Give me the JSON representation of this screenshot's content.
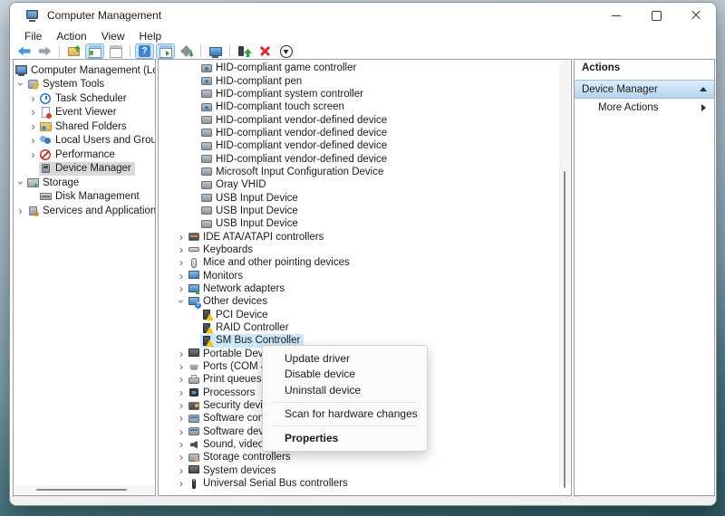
{
  "window": {
    "title": "Computer Management"
  },
  "menus": {
    "items": [
      {
        "label": "File"
      },
      {
        "label": "Action"
      },
      {
        "label": "View"
      },
      {
        "label": "Help"
      }
    ]
  },
  "toolbar": {
    "items": [
      {
        "name": "back-icon",
        "icon": "arrow-left"
      },
      {
        "name": "forward-icon",
        "icon": "arrow-right"
      },
      {
        "name": "toolbar-separator",
        "type": "sep"
      },
      {
        "name": "folder-up-icon",
        "icon": "folder-up"
      },
      {
        "name": "console-tree-icon",
        "icon": "window-tree",
        "active": "1"
      },
      {
        "name": "properties-window-icon",
        "icon": "window-gray"
      },
      {
        "name": "toolbar-separator",
        "type": "sep"
      },
      {
        "name": "help-icon",
        "icon": "help",
        "active": "1"
      },
      {
        "name": "action-pane-icon",
        "icon": "window-play",
        "active": "1"
      },
      {
        "name": "export-list-icon",
        "icon": "gear-export"
      },
      {
        "name": "toolbar-separator",
        "type": "sep"
      },
      {
        "name": "scan-hardware-icon",
        "icon": "monitor-scan"
      },
      {
        "name": "toolbar-separator",
        "type": "sep"
      },
      {
        "name": "update-driver-icon",
        "icon": "device-up"
      },
      {
        "name": "uninstall-device-icon",
        "icon": "red-x"
      },
      {
        "name": "disable-device-icon",
        "icon": "circle-down"
      }
    ]
  },
  "tree": {
    "items": [
      {
        "label": "Computer Management (Local",
        "ind": "0",
        "icon": "computer"
      },
      {
        "label": "System Tools",
        "ind": "1",
        "chev": "down",
        "icon": "tools"
      },
      {
        "label": "Task Scheduler",
        "ind": "2",
        "chev": "right",
        "icon": "clock"
      },
      {
        "label": "Event Viewer",
        "ind": "2",
        "chev": "right",
        "icon": "eventlog"
      },
      {
        "label": "Shared Folders",
        "ind": "2",
        "chev": "right",
        "icon": "sharedfolder"
      },
      {
        "label": "Local Users and Groups",
        "ind": "2",
        "chev": "right",
        "icon": "users"
      },
      {
        "label": "Performance",
        "ind": "2",
        "chev": "right",
        "icon": "performance"
      },
      {
        "label": "Device Manager",
        "ind": "2",
        "icon": "devmgr",
        "sel": "gray"
      },
      {
        "label": "Storage",
        "ind": "1",
        "chev": "down",
        "icon": "storage"
      },
      {
        "label": "Disk Management",
        "ind": "2",
        "icon": "disk"
      },
      {
        "label": "Services and Applications",
        "ind": "1",
        "chev": "right",
        "icon": "services"
      }
    ]
  },
  "devices": {
    "items": [
      {
        "label": "HID-compliant game controller",
        "ind": "2",
        "icon": "hid"
      },
      {
        "label": "HID-compliant pen",
        "ind": "2",
        "icon": "hid"
      },
      {
        "label": "HID-compliant system controller",
        "ind": "2",
        "icon": "input"
      },
      {
        "label": "HID-compliant touch screen",
        "ind": "2",
        "icon": "hid"
      },
      {
        "label": "HID-compliant vendor-defined device",
        "ind": "2",
        "icon": "input"
      },
      {
        "label": "HID-compliant vendor-defined device",
        "ind": "2",
        "icon": "input"
      },
      {
        "label": "HID-compliant vendor-defined device",
        "ind": "2",
        "icon": "input"
      },
      {
        "label": "HID-compliant vendor-defined device",
        "ind": "2",
        "icon": "input"
      },
      {
        "label": "Microsoft Input Configuration Device",
        "ind": "2",
        "icon": "input"
      },
      {
        "label": "Oray VHID",
        "ind": "2",
        "icon": "input"
      },
      {
        "label": "USB Input Device",
        "ind": "2",
        "icon": "input"
      },
      {
        "label": "USB Input Device",
        "ind": "2",
        "icon": "input"
      },
      {
        "label": "USB Input Device",
        "ind": "2",
        "icon": "input"
      },
      {
        "label": "IDE ATA/ATAPI controllers",
        "ind": "1",
        "chev": "right",
        "icon": "ide"
      },
      {
        "label": "Keyboards",
        "ind": "1",
        "chev": "right",
        "icon": "keyboard"
      },
      {
        "label": "Mice and other pointing devices",
        "ind": "1",
        "chev": "right",
        "icon": "mouse"
      },
      {
        "label": "Monitors",
        "ind": "1",
        "chev": "right",
        "icon": "monitor"
      },
      {
        "label": "Network adapters",
        "ind": "1",
        "chev": "right",
        "icon": "network"
      },
      {
        "label": "Other devices",
        "ind": "1",
        "chev": "down",
        "icon": "other"
      },
      {
        "label": "PCI Device",
        "ind": "2",
        "icon": "unknown",
        "warn": "1"
      },
      {
        "label": "RAID Controller",
        "ind": "2",
        "icon": "unknown",
        "warn": "1"
      },
      {
        "label": "SM Bus Controller",
        "ind": "2",
        "icon": "unknown",
        "warn": "1",
        "sel": "blue"
      },
      {
        "label": "Portable Devices",
        "ind": "1",
        "chev": "right",
        "icon": "portable"
      },
      {
        "label": "Ports (COM & LPT)",
        "ind": "1",
        "chev": "right",
        "icon": "ports"
      },
      {
        "label": "Print queues",
        "ind": "1",
        "chev": "right",
        "icon": "printer"
      },
      {
        "label": "Processors",
        "ind": "1",
        "chev": "right",
        "icon": "processor"
      },
      {
        "label": "Security devices",
        "ind": "1",
        "chev": "right",
        "icon": "security"
      },
      {
        "label": "Software components",
        "ind": "1",
        "chev": "right",
        "icon": "software"
      },
      {
        "label": "Software devices",
        "ind": "1",
        "chev": "right",
        "icon": "software"
      },
      {
        "label": "Sound, video and game controllers",
        "ind": "1",
        "chev": "right",
        "icon": "sound"
      },
      {
        "label": "Storage controllers",
        "ind": "1",
        "chev": "right",
        "icon": "storagec"
      },
      {
        "label": "System devices",
        "ind": "1",
        "chev": "right",
        "icon": "system"
      },
      {
        "label": "Universal Serial Bus controllers",
        "ind": "1",
        "chev": "right",
        "icon": "usb"
      }
    ]
  },
  "context_menu": {
    "items": [
      {
        "label": "Update driver"
      },
      {
        "label": "Disable device"
      },
      {
        "label": "Uninstall device"
      },
      {
        "type": "sep"
      },
      {
        "label": "Scan for hardware changes"
      },
      {
        "type": "sep"
      },
      {
        "label": "Properties",
        "bold": "1"
      }
    ]
  },
  "actions": {
    "header": "Actions",
    "group_label": "Device Manager",
    "more_label": "More Actions"
  },
  "colors": {
    "selection_blue": "#cce8ff",
    "selection_gray": "#d9d9d9",
    "warning_yellow": "#f2c21a",
    "actions_group_top": "#ddeefb",
    "actions_group_bottom": "#b4d4ef",
    "desktop_teal": "#2d5b63"
  }
}
